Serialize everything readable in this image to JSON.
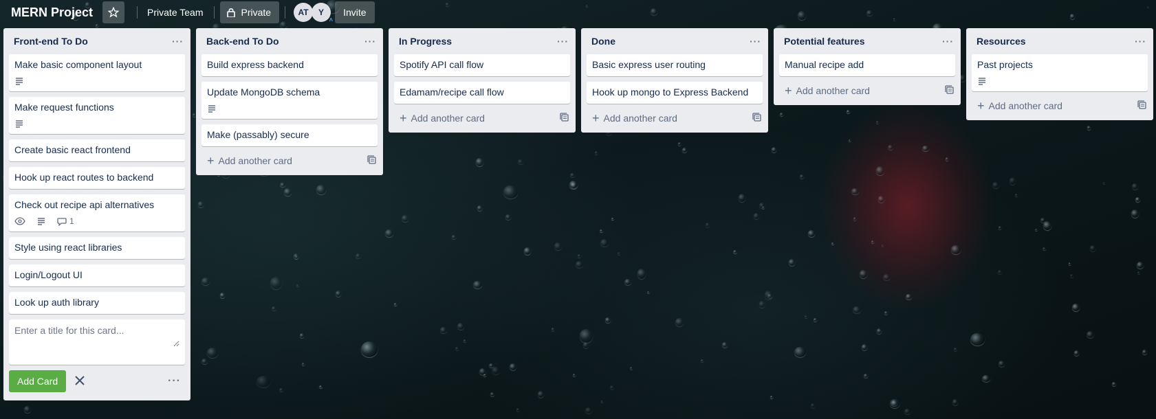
{
  "header": {
    "board_title": "MERN Project",
    "team_label": "Private Team",
    "visibility_label": "Private",
    "avatars": [
      "AT",
      "Y"
    ],
    "invite_label": "Invite"
  },
  "lists": [
    {
      "title": "Front-end To Do",
      "cards": [
        {
          "title": "Make basic component layout",
          "has_description": true
        },
        {
          "title": "Make request functions",
          "has_description": true
        },
        {
          "title": "Create basic react frontend"
        },
        {
          "title": "Hook up react routes to backend"
        },
        {
          "title": "Check out recipe api alternatives",
          "watching": true,
          "has_description": true,
          "comments": "1"
        },
        {
          "title": "Style using react libraries"
        },
        {
          "title": "Login/Logout UI"
        },
        {
          "title": "Look up auth library"
        }
      ],
      "composer": {
        "placeholder": "Enter a title for this card...",
        "add_button": "Add Card"
      }
    },
    {
      "title": "Back-end To Do",
      "cards": [
        {
          "title": "Build express backend"
        },
        {
          "title": "Update MongoDB schema",
          "has_description": true
        },
        {
          "title": "Make (passably) secure"
        }
      ],
      "add_card_label": "Add another card"
    },
    {
      "title": "In Progress",
      "cards": [
        {
          "title": "Spotify API call flow"
        },
        {
          "title": "Edamam/recipe call flow"
        }
      ],
      "add_card_label": "Add another card"
    },
    {
      "title": "Done",
      "cards": [
        {
          "title": "Basic express user routing"
        },
        {
          "title": "Hook up mongo to Express Backend"
        }
      ],
      "add_card_label": "Add another card"
    },
    {
      "title": "Potential features",
      "cards": [
        {
          "title": "Manual recipe add"
        }
      ],
      "add_card_label": "Add another card"
    },
    {
      "title": "Resources",
      "cards": [
        {
          "title": "Past projects",
          "has_description": true
        }
      ],
      "add_card_label": "Add another card"
    }
  ],
  "icons": {
    "star": "star-icon",
    "lock": "lock-icon",
    "description": "description-icon",
    "watch": "eye-icon",
    "comment": "comment-icon",
    "template": "card-template-icon",
    "close": "close-icon",
    "more": "more-icon"
  }
}
